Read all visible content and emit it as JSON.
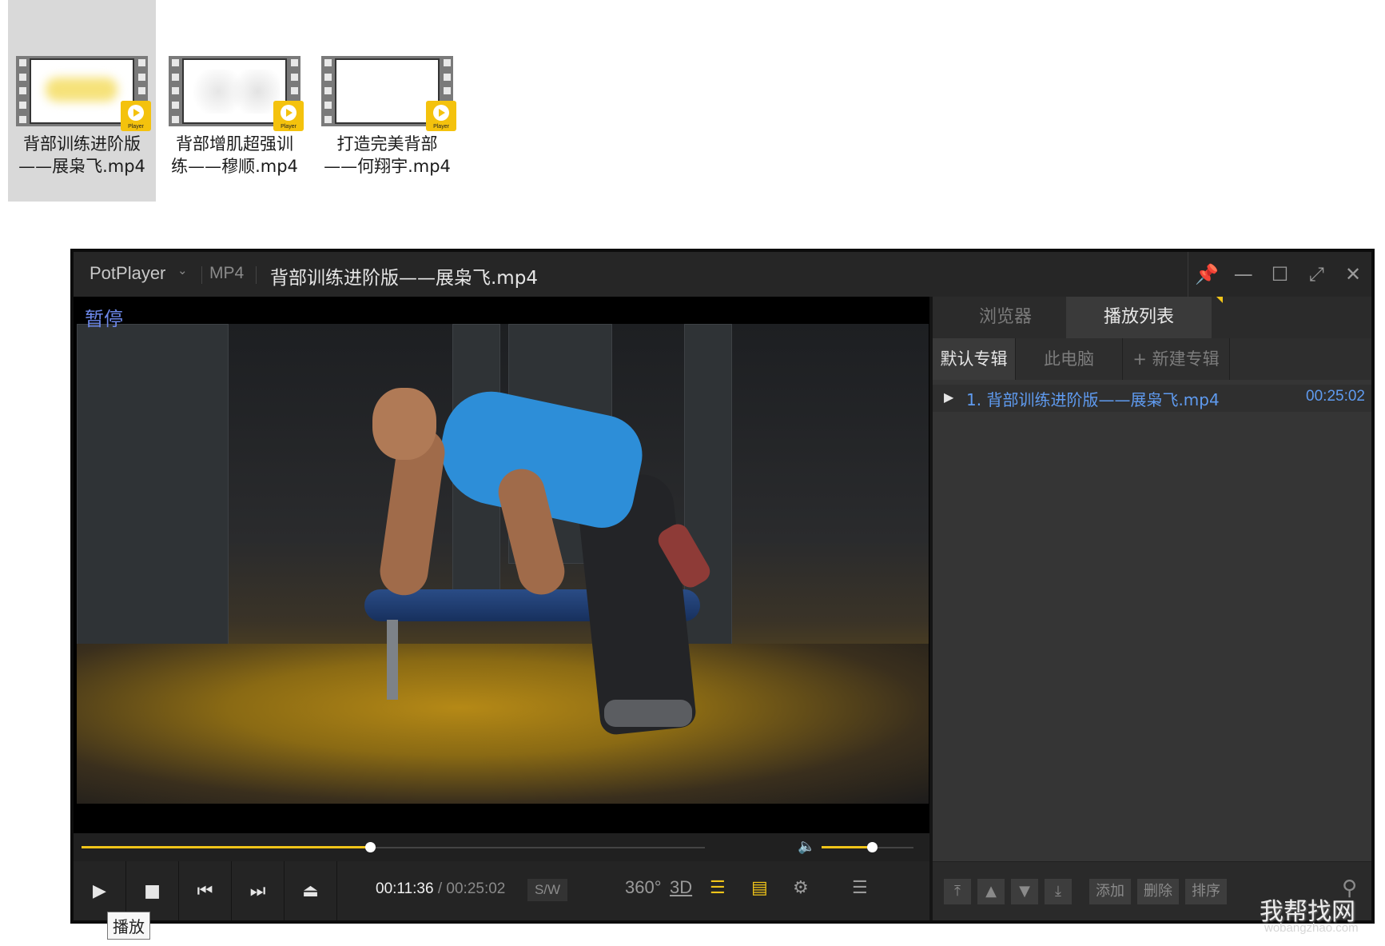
{
  "desktop": {
    "files": [
      {
        "name": "背部训练进阶版——展枭飞.mp4",
        "badge": "Player"
      },
      {
        "name": "背部增肌超强训练——穆顺.mp4",
        "badge": "Player"
      },
      {
        "name": "打造完美背部——何翔宇.mp4",
        "badge": "Player"
      }
    ]
  },
  "player": {
    "app_name": "PotPlayer",
    "format": "MP4",
    "title": "背部训练进阶版——展枭飞.mp4",
    "status_overlay": "暂停",
    "progress": 0.463,
    "volume": 0.55,
    "time_current": "00:11:36",
    "time_separator": "/",
    "time_total": "00:25:02",
    "sw_label": "S/W",
    "icons": {
      "360": "360°",
      "3d": "3D"
    },
    "accent_color": "#f0c419",
    "link_color": "#5f9bf0",
    "tooltip": "播放"
  },
  "panel": {
    "tabs": [
      "浏览器",
      "播放列表"
    ],
    "subtabs": [
      "默认专辑",
      "此电脑",
      "+ 新建专辑"
    ],
    "playlist": [
      {
        "name": "1. 背部训练进阶版——展枭飞.mp4",
        "duration": "00:25:02"
      }
    ],
    "bottom_buttons": [
      "添加",
      "删除",
      "排序"
    ]
  },
  "watermark": {
    "text": "我帮找网",
    "sub": "wobangzhao.com"
  }
}
